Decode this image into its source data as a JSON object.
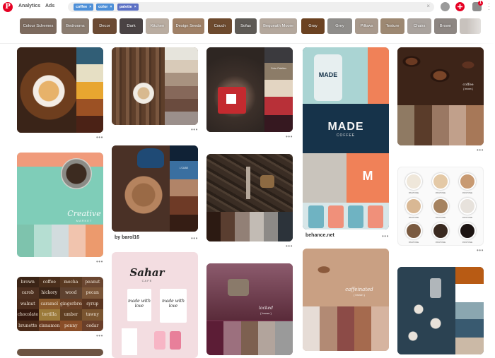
{
  "header": {
    "logo": "P",
    "nav": [
      "Analytics",
      "Ads"
    ],
    "search_chips": [
      "coffee",
      "color",
      "palette"
    ],
    "chip_close": "×",
    "clear": "×",
    "notifications_count": "1"
  },
  "guides": [
    "Colour Schemes",
    "Bedrooms",
    "Decor",
    "Dark",
    "Kitchen",
    "Design Seeds",
    "Couch",
    "Sofas",
    "Bequeath Moore",
    "Gray",
    "Grey",
    "Pillows",
    "Texture",
    "Chairs",
    "Brown"
  ],
  "pins": {
    "c3_title": "MADE",
    "c3_sub": "COFFEE",
    "c3_source": "behance.net",
    "c1_author": "by barol16",
    "c0_creative": "Creative",
    "c0_creative_sub": "MARKET",
    "c1_sahar": "Sahar",
    "c1_sahar_sub": "CAFE",
    "c1_made_with": "made with love",
    "c2_locked": "locked",
    "c2_locked_sub": "{ brown }",
    "c3_caffeinated": "caffeinated",
    "c3_caffeinated_sub": "{ brown }",
    "c4_coffee": "coffee",
    "c4_coffee_sub": "{ brown }",
    "c1_lcube": "L'CUBE",
    "c2_top_text": "Color Palettes",
    "c0_words": [
      [
        "brown",
        "coffee",
        "mocha",
        "peanut"
      ],
      [
        "carob",
        "hickory",
        "wood",
        "pecan"
      ],
      [
        "walnut",
        "caramel",
        "gingerbread",
        "syrup"
      ],
      [
        "chocolate",
        "tortilla",
        "umber",
        "tawny"
      ],
      [
        "brunette",
        "cinnamon",
        "penny",
        "cedar"
      ]
    ],
    "pantone_label": "PANTONE",
    "dots": "•••"
  },
  "colors": {
    "brand": "#e60023",
    "chip": "#4d8fd8"
  }
}
